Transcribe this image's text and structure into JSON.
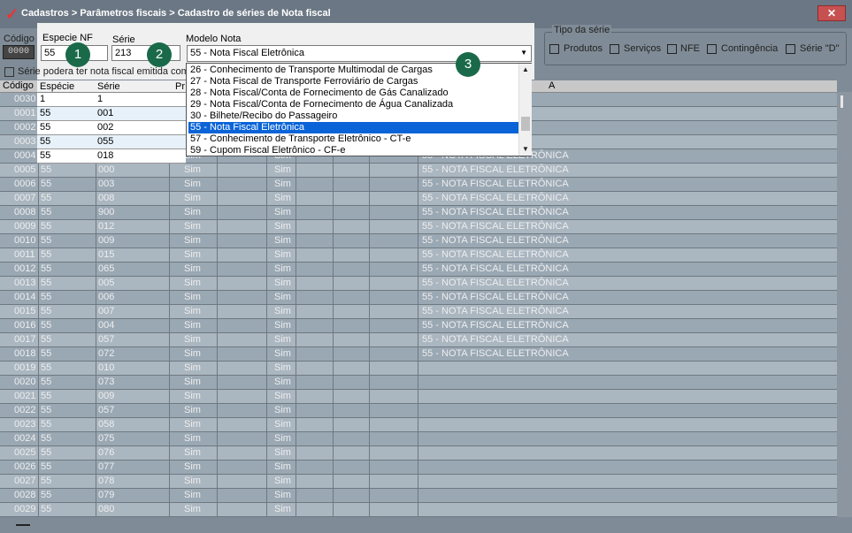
{
  "window": {
    "title": "Cadastros > Parâmetros fiscais > Cadastro de séries de Nota fiscal"
  },
  "form": {
    "codigo_label": "Código",
    "codigo_value": "0000",
    "especie_label": "Especie NF",
    "especie_value": "55",
    "serie_label": "Série",
    "serie_value": "213",
    "modelo_label": "Modelo Nota",
    "modelo_value": "55 - Nota Fiscal Eletrônica",
    "serie_checkbox_label": "Série podera ter nota fiscal emitida com"
  },
  "tipo_serie": {
    "legend": "Tipo da série",
    "options": [
      "Produtos",
      "Serviços",
      "NFE",
      "Contingência",
      "Série \"D\""
    ]
  },
  "badges": [
    "1",
    "2",
    "3"
  ],
  "dropdown": {
    "items": [
      "26 - Conhecimento de Transporte Multimodal de Cargas",
      "27 - Nota Fiscal de Transporte Ferroviário de Cargas",
      "28 - Nota Fiscal/Conta de Fornecimento de Gás Canalizado",
      "29 - Nota Fiscal/Conta de Fornecimento de Água Canalizada",
      "30 - Bilhete/Recibo do Passageiro",
      "55 - Nota Fiscal Eletrônica",
      "57 - Conhecimento de Transporte Eletrônico - CT-e",
      "59 - Cupom Fiscal Eletrônico - CF-e"
    ],
    "selected_index": 5
  },
  "top_table": {
    "headers": [
      "Espécie",
      "Série",
      "Pr"
    ],
    "rows": [
      [
        "1",
        "1"
      ],
      [
        "55",
        "001"
      ],
      [
        "55",
        "002"
      ],
      [
        "55",
        "055"
      ],
      [
        "55",
        "018"
      ]
    ]
  },
  "grid": {
    "header_codigo": "Código",
    "header_descricao": "A",
    "rows": [
      {
        "codigo": "0030",
        "especie": "",
        "serie": "",
        "col1": "",
        "col2": "",
        "desc": "A"
      },
      {
        "codigo": "0001",
        "especie": "",
        "serie": "",
        "col1": "",
        "col2": "",
        "desc": "TRÔNICA"
      },
      {
        "codigo": "0002",
        "especie": "",
        "serie": "",
        "col1": "",
        "col2": "",
        "desc": "TRÔNICA"
      },
      {
        "codigo": "0003",
        "especie": "",
        "serie": "",
        "col1": "",
        "col2": "",
        "desc": "TRÔNICA"
      },
      {
        "codigo": "0004",
        "especie": "",
        "serie": "",
        "col1": "Sim",
        "col2": "Sim",
        "desc": "55 - NOTA FISCAL ELETRÔNICA"
      },
      {
        "codigo": "0005",
        "especie": "55",
        "serie": "000",
        "col1": "Sim",
        "col2": "Sim",
        "desc": "55 - NOTA FISCAL ELETRÔNICA"
      },
      {
        "codigo": "0006",
        "especie": "55",
        "serie": "003",
        "col1": "Sim",
        "col2": "Sim",
        "desc": "55 - NOTA FISCAL ELETRÔNICA"
      },
      {
        "codigo": "0007",
        "especie": "55",
        "serie": "008",
        "col1": "Sim",
        "col2": "Sim",
        "desc": "55 - NOTA FISCAL ELETRÔNICA"
      },
      {
        "codigo": "0008",
        "especie": "55",
        "serie": "900",
        "col1": "Sim",
        "col2": "Sim",
        "desc": "55 - NOTA FISCAL ELETRÔNICA"
      },
      {
        "codigo": "0009",
        "especie": "55",
        "serie": "012",
        "col1": "Sim",
        "col2": "Sim",
        "desc": "55 - NOTA FISCAL ELETRÔNICA"
      },
      {
        "codigo": "0010",
        "especie": "55",
        "serie": "009",
        "col1": "Sim",
        "col2": "Sim",
        "desc": "55 - NOTA FISCAL ELETRÔNICA"
      },
      {
        "codigo": "0011",
        "especie": "55",
        "serie": "015",
        "col1": "Sim",
        "col2": "Sim",
        "desc": "55 - NOTA FISCAL ELETRÔNICA"
      },
      {
        "codigo": "0012",
        "especie": "55",
        "serie": "065",
        "col1": "Sim",
        "col2": "Sim",
        "desc": "55 - NOTA FISCAL ELETRÔNICA"
      },
      {
        "codigo": "0013",
        "especie": "55",
        "serie": "005",
        "col1": "Sim",
        "col2": "Sim",
        "desc": "55 - NOTA FISCAL ELETRÔNICA"
      },
      {
        "codigo": "0014",
        "especie": "55",
        "serie": "006",
        "col1": "Sim",
        "col2": "Sim",
        "desc": "55 - NOTA FISCAL ELETRÔNICA"
      },
      {
        "codigo": "0015",
        "especie": "55",
        "serie": "007",
        "col1": "Sim",
        "col2": "Sim",
        "desc": "55 - NOTA FISCAL ELETRÔNICA"
      },
      {
        "codigo": "0016",
        "especie": "55",
        "serie": "004",
        "col1": "Sim",
        "col2": "Sim",
        "desc": "55 - NOTA FISCAL ELETRÔNICA"
      },
      {
        "codigo": "0017",
        "especie": "55",
        "serie": "057",
        "col1": "Sim",
        "col2": "Sim",
        "desc": "55 - NOTA FISCAL ELETRÔNICA"
      },
      {
        "codigo": "0018",
        "especie": "55",
        "serie": "072",
        "col1": "Sim",
        "col2": "Sim",
        "desc": "55 - NOTA FISCAL ELETRÔNICA"
      },
      {
        "codigo": "0019",
        "especie": "55",
        "serie": "010",
        "col1": "Sim",
        "col2": "Sim",
        "desc": ""
      },
      {
        "codigo": "0020",
        "especie": "55",
        "serie": "073",
        "col1": "Sim",
        "col2": "Sim",
        "desc": ""
      },
      {
        "codigo": "0021",
        "especie": "55",
        "serie": "009",
        "col1": "Sim",
        "col2": "Sim",
        "desc": ""
      },
      {
        "codigo": "0022",
        "especie": "55",
        "serie": "057",
        "col1": "Sim",
        "col2": "Sim",
        "desc": ""
      },
      {
        "codigo": "0023",
        "especie": "55",
        "serie": "058",
        "col1": "Sim",
        "col2": "Sim",
        "desc": ""
      },
      {
        "codigo": "0024",
        "especie": "55",
        "serie": "075",
        "col1": "Sim",
        "col2": "Sim",
        "desc": ""
      },
      {
        "codigo": "0025",
        "especie": "55",
        "serie": "076",
        "col1": "Sim",
        "col2": "Sim",
        "desc": ""
      },
      {
        "codigo": "0026",
        "especie": "55",
        "serie": "077",
        "col1": "Sim",
        "col2": "Sim",
        "desc": ""
      },
      {
        "codigo": "0027",
        "especie": "55",
        "serie": "078",
        "col1": "Sim",
        "col2": "Sim",
        "desc": ""
      },
      {
        "codigo": "0028",
        "especie": "55",
        "serie": "079",
        "col1": "Sim",
        "col2": "Sim",
        "desc": ""
      },
      {
        "codigo": "0029",
        "especie": "55",
        "serie": "080",
        "col1": "Sim",
        "col2": "Sim",
        "desc": ""
      }
    ]
  },
  "colors": {
    "window_bg": "#7f8b96",
    "selection": "#0a64d7",
    "badge": "#1a6a4a",
    "close": "#c75050",
    "row_alt": "#9aa8b4"
  }
}
